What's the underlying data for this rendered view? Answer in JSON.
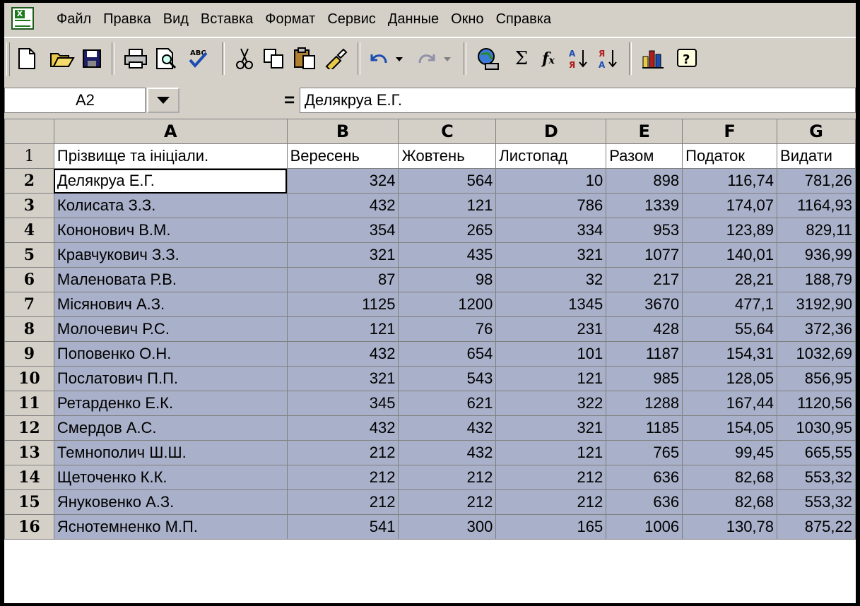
{
  "menu": {
    "items": [
      {
        "label": "Файл",
        "name": "menu-file"
      },
      {
        "label": "Правка",
        "name": "menu-edit"
      },
      {
        "label": "Вид",
        "name": "menu-view"
      },
      {
        "label": "Вставка",
        "name": "menu-insert"
      },
      {
        "label": "Формат",
        "name": "menu-format"
      },
      {
        "label": "Сервис",
        "name": "menu-tools"
      },
      {
        "label": "Данные",
        "name": "menu-data"
      },
      {
        "label": "Окно",
        "name": "menu-window"
      },
      {
        "label": "Справка",
        "name": "menu-help"
      }
    ]
  },
  "toolbar": {
    "icons": [
      "new-icon",
      "open-icon",
      "save-icon",
      "print-icon",
      "print-preview-icon",
      "spelling-icon",
      "cut-icon",
      "copy-icon",
      "paste-icon",
      "format-painter-icon",
      "undo-icon",
      "redo-icon",
      "web-icon",
      "autosum-icon",
      "function-icon",
      "sort-ascending-icon",
      "sort-descending-icon",
      "chart-wizard-icon",
      "help-icon"
    ]
  },
  "formula_bar": {
    "name_box": "A2",
    "equals": "=",
    "content": "Делякруа Е.Г."
  },
  "sheet": {
    "columns": [
      "A",
      "B",
      "C",
      "D",
      "E",
      "F",
      "G"
    ],
    "row_numbers": [
      "1",
      "2",
      "3",
      "4",
      "5",
      "6",
      "7",
      "8",
      "9",
      "10",
      "11",
      "12",
      "13",
      "14",
      "15",
      "16"
    ],
    "header": [
      "Прізвище та ініціали.",
      "Вересень",
      "Жовтень",
      "Листопад",
      "Разом",
      "Податок",
      "Видати"
    ],
    "rows": [
      [
        "Делякруа Е.Г.",
        "324",
        "564",
        "10",
        "898",
        "116,74",
        "781,26"
      ],
      [
        "Колисата З.З.",
        "432",
        "121",
        "786",
        "1339",
        "174,07",
        "1164,93"
      ],
      [
        "Кононович В.М.",
        "354",
        "265",
        "334",
        "953",
        "123,89",
        "829,11"
      ],
      [
        "Кравчукович З.З.",
        "321",
        "435",
        "321",
        "1077",
        "140,01",
        "936,99"
      ],
      [
        "Маленовата Р.В.",
        "87",
        "98",
        "32",
        "217",
        "28,21",
        "188,79"
      ],
      [
        "Місянович А.З.",
        "1125",
        "1200",
        "1345",
        "3670",
        "477,1",
        "3192,90"
      ],
      [
        "Молочевич Р.С.",
        "121",
        "76",
        "231",
        "428",
        "55,64",
        "372,36"
      ],
      [
        "Поповенко О.Н.",
        "432",
        "654",
        "101",
        "1187",
        "154,31",
        "1032,69"
      ],
      [
        "Послатович П.П.",
        "321",
        "543",
        "121",
        "985",
        "128,05",
        "856,95"
      ],
      [
        "Ретарденко Е.К.",
        "345",
        "621",
        "322",
        "1288",
        "167,44",
        "1120,56"
      ],
      [
        "Смердов А.С.",
        "432",
        "432",
        "321",
        "1185",
        "154,05",
        "1030,95"
      ],
      [
        "Темнополич Ш.Ш.",
        "212",
        "432",
        "121",
        "765",
        "99,45",
        "665,55"
      ],
      [
        "Щеточенко К.К.",
        "212",
        "212",
        "212",
        "636",
        "82,68",
        "553,32"
      ],
      [
        "Януковенко А.З.",
        "212",
        "212",
        "212",
        "636",
        "82,68",
        "553,32"
      ],
      [
        "Яснотемненко М.П.",
        "541",
        "300",
        "165",
        "1006",
        "130,78",
        "875,22"
      ]
    ]
  },
  "colors": {
    "selection": "#a9b0c9",
    "chrome": "#d4d0c8"
  }
}
